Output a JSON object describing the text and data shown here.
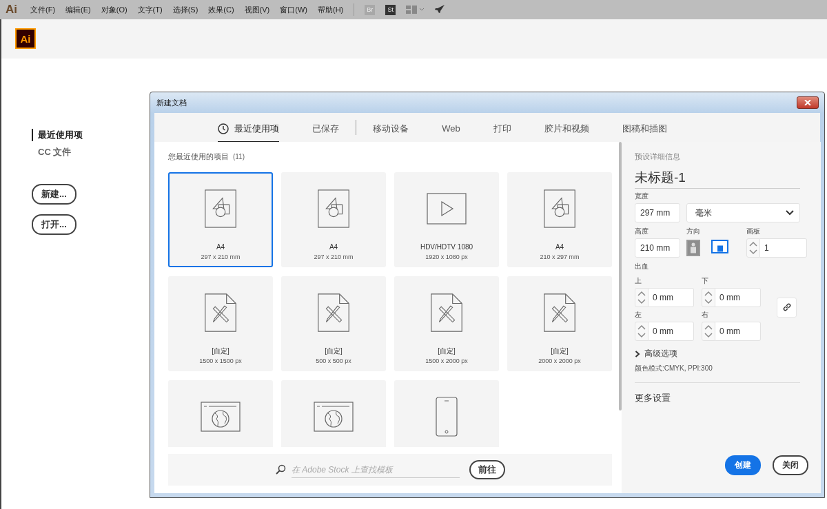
{
  "menu_bar": {
    "app_logo": "Ai",
    "menus": [
      "文件(F)",
      "编辑(E)",
      "对象(O)",
      "文字(T)",
      "选择(S)",
      "效果(C)",
      "视图(V)",
      "窗口(W)",
      "帮助(H)"
    ],
    "bridge": "Br",
    "stock": "St"
  },
  "home": {
    "logo": "Ai",
    "nav": [
      {
        "label": "最近使用项",
        "selected": true
      },
      {
        "label": "CC 文件",
        "selected": false
      }
    ],
    "buttons": [
      "新建...",
      "打开..."
    ]
  },
  "dialog": {
    "title": "新建文档",
    "tabs": [
      {
        "label": "最近使用项",
        "selected": true
      },
      {
        "label": "已保存",
        "selected": false
      },
      {
        "label": "移动设备",
        "selected": false
      },
      {
        "label": "Web",
        "selected": false
      },
      {
        "label": "打印",
        "selected": false
      },
      {
        "label": "胶片和视频",
        "selected": false
      },
      {
        "label": "图稿和插图",
        "selected": false
      }
    ],
    "recent": {
      "heading": "您最近使用的项目",
      "count": "(11)",
      "presets": [
        {
          "kind": "doc",
          "name": "A4",
          "size": "297 x 210 mm",
          "selected": true
        },
        {
          "kind": "doc",
          "name": "A4",
          "size": "297 x 210 mm",
          "selected": false
        },
        {
          "kind": "video",
          "name": "HDV/HDTV 1080",
          "size": "1920 x 1080 px",
          "selected": false
        },
        {
          "kind": "doc",
          "name": "A4",
          "size": "210 x 297 mm",
          "selected": false
        },
        {
          "kind": "custom",
          "name": "[自定]",
          "size": "1500 x 1500 px",
          "selected": false
        },
        {
          "kind": "custom",
          "name": "[自定]",
          "size": "500 x 500 px",
          "selected": false
        },
        {
          "kind": "custom",
          "name": "[自定]",
          "size": "1500 x 2000 px",
          "selected": false
        },
        {
          "kind": "custom",
          "name": "[自定]",
          "size": "2000 x 2000 px",
          "selected": false
        },
        {
          "kind": "web",
          "selected": false
        },
        {
          "kind": "web",
          "selected": false
        },
        {
          "kind": "mobile",
          "selected": false
        }
      ]
    },
    "stock_search": {
      "placeholder": "在 Adobe Stock 上查找模板",
      "button": "前往"
    },
    "details": {
      "heading": "预设详细信息",
      "name": "未标题-1",
      "width": {
        "label": "宽度",
        "value": "297 mm"
      },
      "units": "毫米",
      "height": {
        "label": "高度",
        "value": "210 mm"
      },
      "orientation": {
        "label": "方向",
        "options": [
          {
            "kind": "portrait",
            "selected": false
          },
          {
            "kind": "landscape",
            "selected": true
          }
        ]
      },
      "artboards": {
        "label": "画板",
        "value": "1"
      },
      "bleed": {
        "label": "出血",
        "sides": [
          {
            "label": "上",
            "value": "0 mm"
          },
          {
            "label": "下",
            "value": "0 mm"
          },
          {
            "label": "左",
            "value": "0 mm"
          },
          {
            "label": "右",
            "value": "0 mm"
          }
        ]
      },
      "advanced": {
        "label": "高级选项",
        "expanded": false
      },
      "color_mode": "颜色模式:CMYK, PPI:300",
      "more_settings": "更多设置",
      "buttons": [
        {
          "label": "创建",
          "kind": "primary"
        },
        {
          "label": "关闭",
          "kind": "secondary"
        }
      ]
    }
  }
}
